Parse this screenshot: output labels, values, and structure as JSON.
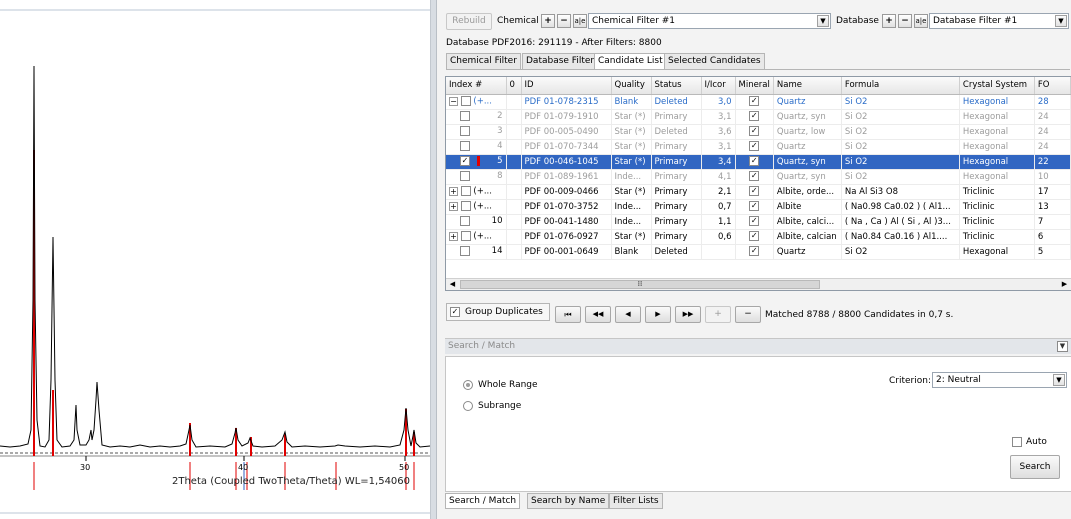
{
  "chart": {
    "x_axis_title": "2Theta (Coupled TwoTheta/Theta) WL=1,54060",
    "x_ticks": [
      "30",
      "40",
      "50"
    ],
    "line_color": "#000000",
    "reference_color": "#e00000"
  },
  "toolbar": {
    "rebuild_label": "Rebuild",
    "chemical_label": "Chemical",
    "chemical_filter": "Chemical Filter #1",
    "database_label": "Database",
    "database_filter": "Database Filter #1",
    "plus": "+",
    "minus": "−",
    "abc": "a|e"
  },
  "database_info": "Database PDF2016: 291119 - After Filters: 8800",
  "tabs": [
    "Chemical Filter",
    "Database Filter",
    "Candidate List",
    "Selected Candidates"
  ],
  "grid": {
    "columns": [
      "Index #",
      "0",
      "ID",
      "Quality",
      "Status",
      "I/Icor",
      "Mineral",
      "Name",
      "Formula",
      "Crystal System",
      "FO"
    ],
    "rows": [
      {
        "tree": "−",
        "mark": "",
        "index": "(+...",
        "id": "PDF 01-078-2315",
        "quality": "Blank",
        "status": "Deleted",
        "icor": "3,0",
        "mineral": "✓",
        "name": "Quartz",
        "formula": "Si O2",
        "crystal": "Hexagonal",
        "fo": "28"
      },
      {
        "tree": "",
        "mark": "",
        "index": "2",
        "id": "PDF 01-079-1910",
        "quality": "Star (*)",
        "status": "Primary",
        "icor": "3,1",
        "mineral": "✓",
        "name": "Quartz, syn",
        "formula": "Si O2",
        "crystal": "Hexagonal",
        "fo": "24"
      },
      {
        "tree": "",
        "mark": "",
        "index": "3",
        "id": "PDF 00-005-0490",
        "quality": "Star (*)",
        "status": "Deleted",
        "icor": "3,6",
        "mineral": "✓",
        "name": "Quartz, low",
        "formula": "Si O2",
        "crystal": "Hexagonal",
        "fo": "24"
      },
      {
        "tree": "",
        "mark": "",
        "index": "4",
        "id": "PDF 01-070-7344",
        "quality": "Star (*)",
        "status": "Primary",
        "icor": "3,1",
        "mineral": "✓",
        "name": "Quartz",
        "formula": "Si O2",
        "crystal": "Hexagonal",
        "fo": "24"
      },
      {
        "tree": "",
        "mark": "✓",
        "index": "5",
        "id": "PDF 00-046-1045",
        "quality": "Star (*)",
        "status": "Primary",
        "icor": "3,4",
        "mineral": "✓",
        "name": "Quartz, syn",
        "formula": "Si O2",
        "crystal": "Hexagonal",
        "fo": "22"
      },
      {
        "tree": "",
        "mark": "",
        "index": "8",
        "id": "PDF 01-089-1961",
        "quality": "Inde...",
        "status": "Primary",
        "icor": "4,1",
        "mineral": "✓",
        "name": "Quartz, syn",
        "formula": "Si O2",
        "crystal": "Hexagonal",
        "fo": "10"
      },
      {
        "tree": "+",
        "mark": "",
        "index": "(+...",
        "id": "PDF 00-009-0466",
        "quality": "Star (*)",
        "status": "Primary",
        "icor": "2,1",
        "mineral": "✓",
        "name": "Albite, orde...",
        "formula": "Na Al Si3 O8",
        "crystal": "Triclinic",
        "fo": "17"
      },
      {
        "tree": "+",
        "mark": "",
        "index": "(+...",
        "id": "PDF 01-070-3752",
        "quality": "Inde...",
        "status": "Primary",
        "icor": "0,7",
        "mineral": "✓",
        "name": "Albite",
        "formula": "( Na0.98 Ca0.02 ) ( Al1...",
        "crystal": "Triclinic",
        "fo": "13"
      },
      {
        "tree": "",
        "mark": "",
        "index": "10",
        "id": "PDF 00-041-1480",
        "quality": "Inde...",
        "status": "Primary",
        "icor": "1,1",
        "mineral": "✓",
        "name": "Albite, calci...",
        "formula": "( Na , Ca ) Al ( Si , Al )3...",
        "crystal": "Triclinic",
        "fo": "7"
      },
      {
        "tree": "+",
        "mark": "",
        "index": "(+...",
        "id": "PDF 01-076-0927",
        "quality": "Star (*)",
        "status": "Primary",
        "icor": "0,6",
        "mineral": "✓",
        "name": "Albite, calcian",
        "formula": "( Na0.84 Ca0.16 ) Al1....",
        "crystal": "Triclinic",
        "fo": "6"
      },
      {
        "tree": "",
        "mark": "",
        "index": "14",
        "id": "PDF 00-001-0649",
        "quality": "Blank",
        "status": "Deleted",
        "icor": "",
        "mineral": "✓",
        "name": "Quartz",
        "formula": "Si O2",
        "crystal": "Hexagonal",
        "fo": "5"
      }
    ]
  },
  "group_duplicates_label": "Group Duplicates",
  "nav_buttons": [
    "⏮",
    "◀◀",
    "◀",
    "▶",
    "▶▶",
    "+",
    "−"
  ],
  "matched_text": "Matched 8788 / 8800 Candidates in 0,7 s.",
  "search_match": {
    "header": "Search / Match",
    "whole_range": "Whole Range",
    "subrange": "Subrange",
    "criterion_label": "Criterion:",
    "criterion_value": "2: Neutral",
    "auto_label": "Auto",
    "search_button": "Search"
  },
  "bottom_tabs": [
    "Search / Match",
    "Search by Name",
    "Filter Lists"
  ]
}
